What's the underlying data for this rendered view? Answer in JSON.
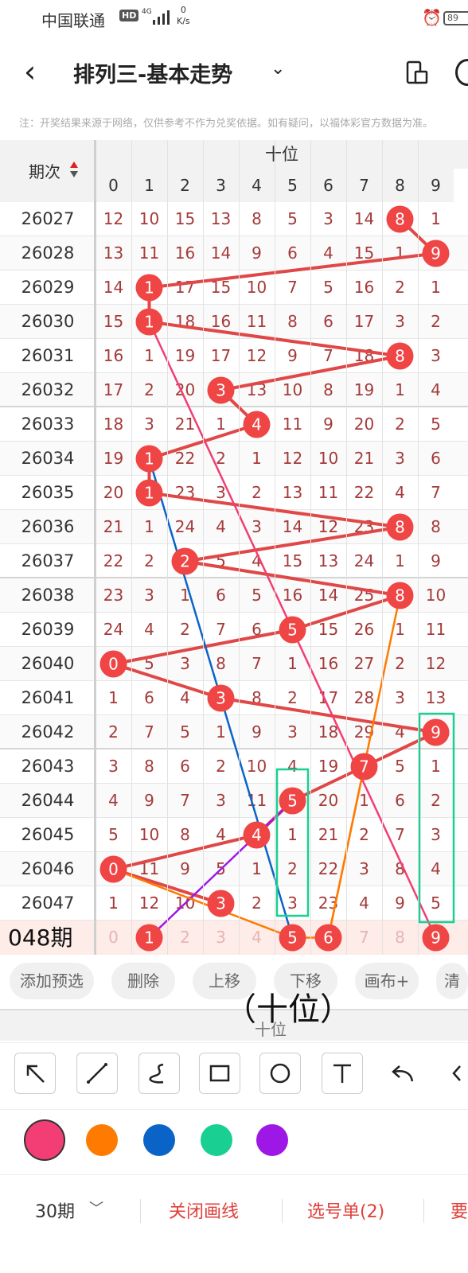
{
  "status_bar": {
    "carrier": "中国联通",
    "hd": "HD",
    "signal": "4G",
    "speed_value": "0",
    "speed_unit": "K/s",
    "battery": "89"
  },
  "header": {
    "title": "排列三-基本走势",
    "back_icon": "chevron-left-icon",
    "dropdown_icon": "chevron-down-icon"
  },
  "notice": "注：开奖结果来源于网络，仅供参考不作为兑奖依据。如有疑问，以福体彩官方数据为准。",
  "table": {
    "period_header": "期次",
    "group_header": "十位",
    "digit_headers": [
      "0",
      "1",
      "2",
      "3",
      "4",
      "5",
      "6",
      "7",
      "8",
      "9"
    ],
    "rows": [
      {
        "period": "26027",
        "values": [
          "12",
          "10",
          "15",
          "13",
          "8",
          "5",
          "3",
          "14",
          "8",
          "1"
        ],
        "hit": 8
      },
      {
        "period": "26028",
        "values": [
          "13",
          "11",
          "16",
          "14",
          "9",
          "6",
          "4",
          "15",
          "1",
          "9"
        ],
        "hit": 9
      },
      {
        "period": "26029",
        "values": [
          "14",
          "1",
          "17",
          "15",
          "10",
          "7",
          "5",
          "16",
          "2",
          "1"
        ],
        "hit": 1
      },
      {
        "period": "26030",
        "values": [
          "15",
          "1",
          "18",
          "16",
          "11",
          "8",
          "6",
          "17",
          "3",
          "2"
        ],
        "hit": 1
      },
      {
        "period": "26031",
        "values": [
          "16",
          "1",
          "19",
          "17",
          "12",
          "9",
          "7",
          "18",
          "8",
          "3"
        ],
        "hit": 8
      },
      {
        "period": "26032",
        "values": [
          "17",
          "2",
          "20",
          "3",
          "13",
          "10",
          "8",
          "19",
          "1",
          "4"
        ],
        "hit": 3
      },
      {
        "period": "26033",
        "values": [
          "18",
          "3",
          "21",
          "1",
          "4",
          "11",
          "9",
          "20",
          "2",
          "5"
        ],
        "hit": 4
      },
      {
        "period": "26034",
        "values": [
          "19",
          "1",
          "22",
          "2",
          "1",
          "12",
          "10",
          "21",
          "3",
          "6"
        ],
        "hit": 1
      },
      {
        "period": "26035",
        "values": [
          "20",
          "1",
          "23",
          "3",
          "2",
          "13",
          "11",
          "22",
          "4",
          "7"
        ],
        "hit": 1
      },
      {
        "period": "26036",
        "values": [
          "21",
          "1",
          "24",
          "4",
          "3",
          "14",
          "12",
          "23",
          "8",
          "8"
        ],
        "hit": 8
      },
      {
        "period": "26037",
        "values": [
          "22",
          "2",
          "2",
          "5",
          "4",
          "15",
          "13",
          "24",
          "1",
          "9"
        ],
        "hit": 2
      },
      {
        "period": "26038",
        "values": [
          "23",
          "3",
          "1",
          "6",
          "5",
          "16",
          "14",
          "25",
          "8",
          "10"
        ],
        "hit": 8
      },
      {
        "period": "26039",
        "values": [
          "24",
          "4",
          "2",
          "7",
          "6",
          "5",
          "15",
          "26",
          "1",
          "11"
        ],
        "hit": 5
      },
      {
        "period": "26040",
        "values": [
          "0",
          "5",
          "3",
          "8",
          "7",
          "1",
          "16",
          "27",
          "2",
          "12"
        ],
        "hit": 0
      },
      {
        "period": "26041",
        "values": [
          "1",
          "6",
          "4",
          "3",
          "8",
          "2",
          "17",
          "28",
          "3",
          "13"
        ],
        "hit": 3
      },
      {
        "period": "26042",
        "values": [
          "2",
          "7",
          "5",
          "1",
          "9",
          "3",
          "18",
          "29",
          "4",
          "9"
        ],
        "hit": 9
      },
      {
        "period": "26043",
        "values": [
          "3",
          "8",
          "6",
          "2",
          "10",
          "4",
          "19",
          "7",
          "5",
          "1"
        ],
        "hit": 7
      },
      {
        "period": "26044",
        "values": [
          "4",
          "9",
          "7",
          "3",
          "11",
          "5",
          "20",
          "1",
          "6",
          "2"
        ],
        "hit": 5
      },
      {
        "period": "26045",
        "values": [
          "5",
          "10",
          "8",
          "4",
          "4",
          "1",
          "21",
          "2",
          "7",
          "3"
        ],
        "hit": 4
      },
      {
        "period": "26046",
        "values": [
          "0",
          "11",
          "9",
          "5",
          "1",
          "2",
          "22",
          "3",
          "8",
          "4"
        ],
        "hit": 0
      },
      {
        "period": "26047",
        "values": [
          "1",
          "12",
          "10",
          "3",
          "2",
          "3",
          "23",
          "4",
          "9",
          "5"
        ],
        "hit": 3
      }
    ],
    "prediction": {
      "label": "048期",
      "values": [
        "0",
        "1",
        "2",
        "3",
        "4",
        "5",
        "6",
        "7",
        "8",
        "9"
      ],
      "selected": [
        1,
        5,
        6,
        9
      ]
    }
  },
  "actions": [
    "添加预选",
    "删除",
    "上移",
    "下移",
    "画布+",
    "清"
  ],
  "overlay_label": "（十位）",
  "ghost_header": "十位",
  "tools": [
    "arrow-tool-icon",
    "line-tool-icon",
    "curve-tool-icon",
    "rectangle-tool-icon",
    "circle-tool-icon",
    "text-tool-icon",
    "undo-icon",
    "eraser-icon"
  ],
  "colors": [
    "#f23e74",
    "#ff7a00",
    "#0a64c8",
    "#19cf92",
    "#9d18e6"
  ],
  "bottom_bar": {
    "period": "30期",
    "close_lines": "关闭画线",
    "selected_list": "选号单(2)",
    "more": "要"
  },
  "theme": {
    "hit": "#ef4545",
    "text": "#a53a3a",
    "line": "#e04848"
  }
}
